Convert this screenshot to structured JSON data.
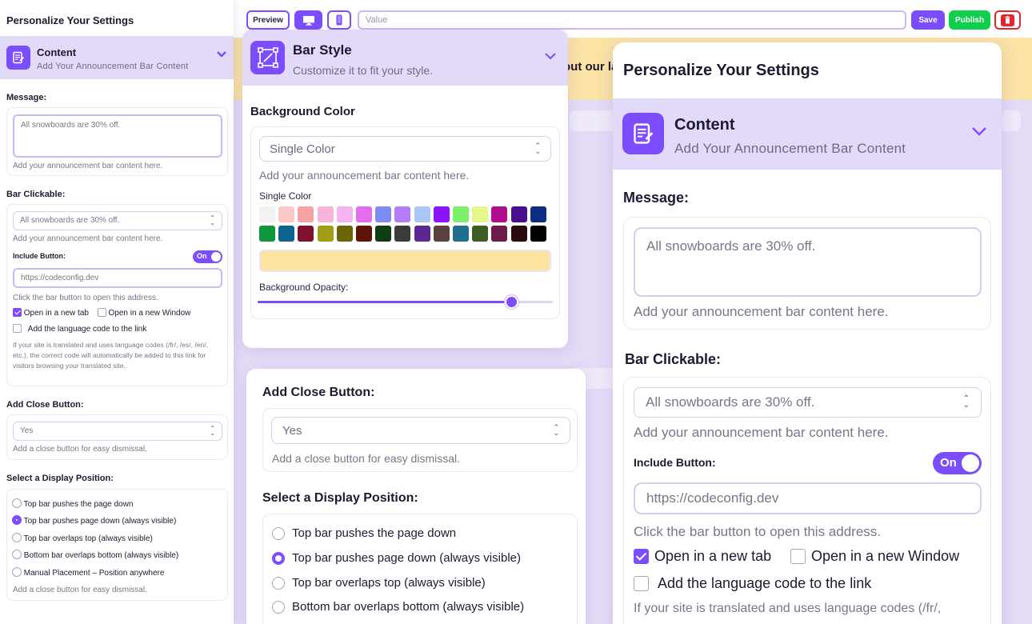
{
  "colors": {
    "accent": "#7c4dff",
    "publish": "#0fcf4c",
    "delete": "#e5242b",
    "announce_bg": "#fde49e",
    "header_bg": "#e3dafa"
  },
  "toolbar": {
    "preview_label": "Preview",
    "desktop_icon": "desktop-icon",
    "mobile_icon": "mobile-icon",
    "value_placeholder": "Value",
    "save_label": "Save",
    "publish_label": "Publish",
    "delete_icon": "trash-icon"
  },
  "preview": {
    "announcement_text": "out our la"
  },
  "settings": {
    "title": "Personalize Your Settings",
    "content_section": {
      "title": "Content",
      "subtitle": "Add Your Announcement  Bar Content"
    },
    "message": {
      "label": "Message:",
      "value": "All snowboards are 30% off.",
      "hint": "Add your announcement bar content here."
    },
    "bar_clickable": {
      "label": "Bar Clickable:",
      "select_value": "All snowboards are 30% off.",
      "hint": "Add your announcement bar content here.",
      "include_button_label": "Include Button:",
      "toggle_label": "On",
      "toggle_on": true,
      "url_value": "https://codeconfig.dev",
      "url_hint": "Click the bar button to open this address.",
      "open_new_tab": "Open in a new tab",
      "open_new_tab_checked": true,
      "open_new_window": "Open in a new Window",
      "open_new_window_checked": false,
      "language_code": "Add the language code to the link",
      "language_code_checked": false,
      "language_note": "If your site is translated and uses language codes (/fr/, /es/, /en/, etc.), the correct code will automatically be added to this link for visitors browsing your translated site."
    },
    "close_button": {
      "label": "Add Close Button:",
      "value": "Yes",
      "hint": "Add a close button for easy dismissal."
    },
    "display_position": {
      "label": "Select a Display Position:",
      "selected_index": 1,
      "options": [
        "Top bar pushes the page down",
        "Top bar pushes page down (always visible)",
        "Top bar overlaps top (always visible)",
        "Bottom bar overlaps bottom (always visible)",
        "Manual Placement – Position anywhere"
      ],
      "hint": "Add a close button for easy dismissal."
    },
    "right_partial": {
      "language_note_line": "If your site is translated and uses language codes (/fr/,"
    }
  },
  "bar_style": {
    "title": "Bar Style",
    "subtitle": "Customize it to fit your style.",
    "background_color_label": "Background Color",
    "select_value": "Single Color",
    "hint": "Add your announcement bar content here.",
    "single_color_label": "Single Color",
    "swatches": [
      "#f2f2f2",
      "#fcc8c8",
      "#f6a3a3",
      "#f8b4d8",
      "#f6b3f2",
      "#e46cf0",
      "#7d8cf5",
      "#b57cf5",
      "#a9c6f7",
      "#8a14fa",
      "#7df06a",
      "#e3f78a",
      "#b0108f",
      "#4a0f8c",
      "#0c2d80",
      "#10963c",
      "#0d648e",
      "#80112f",
      "#a19d15",
      "#6a6608",
      "#5d1407",
      "#0f3d13",
      "#3b3b3b",
      "#5b2892",
      "#5b4040",
      "#1f6f8c",
      "#3e5c26",
      "#6d1c4a",
      "#2a0b0b",
      "#000000"
    ],
    "selected_color": "#fde49e",
    "opacity_label": "Background Opacity:",
    "opacity_value": 0.86
  }
}
